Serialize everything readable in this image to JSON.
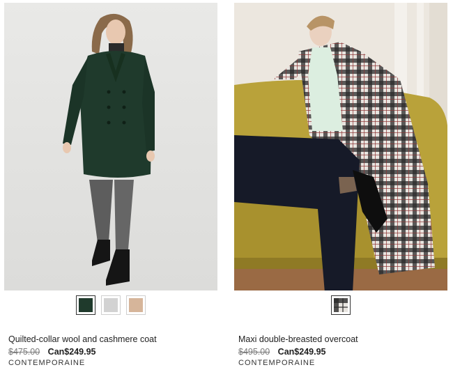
{
  "products": [
    {
      "name": "Quilted-collar wool and cashmere coat",
      "old_price": "$475.00",
      "sale_price": "Can$249.95",
      "brand": "CONTEMPORAINE",
      "swatches": [
        {
          "color": "#1f3a2c",
          "selected": true
        },
        {
          "color": "#d2d2d2",
          "selected": false
        },
        {
          "color": "#d6b59a",
          "selected": false
        }
      ]
    },
    {
      "name": "Maxi double-breasted overcoat",
      "old_price": "$495.00",
      "sale_price": "Can$249.95",
      "brand": "CONTEMPORAINE",
      "swatches": [
        {
          "color": "plaid",
          "selected": true
        }
      ]
    }
  ]
}
